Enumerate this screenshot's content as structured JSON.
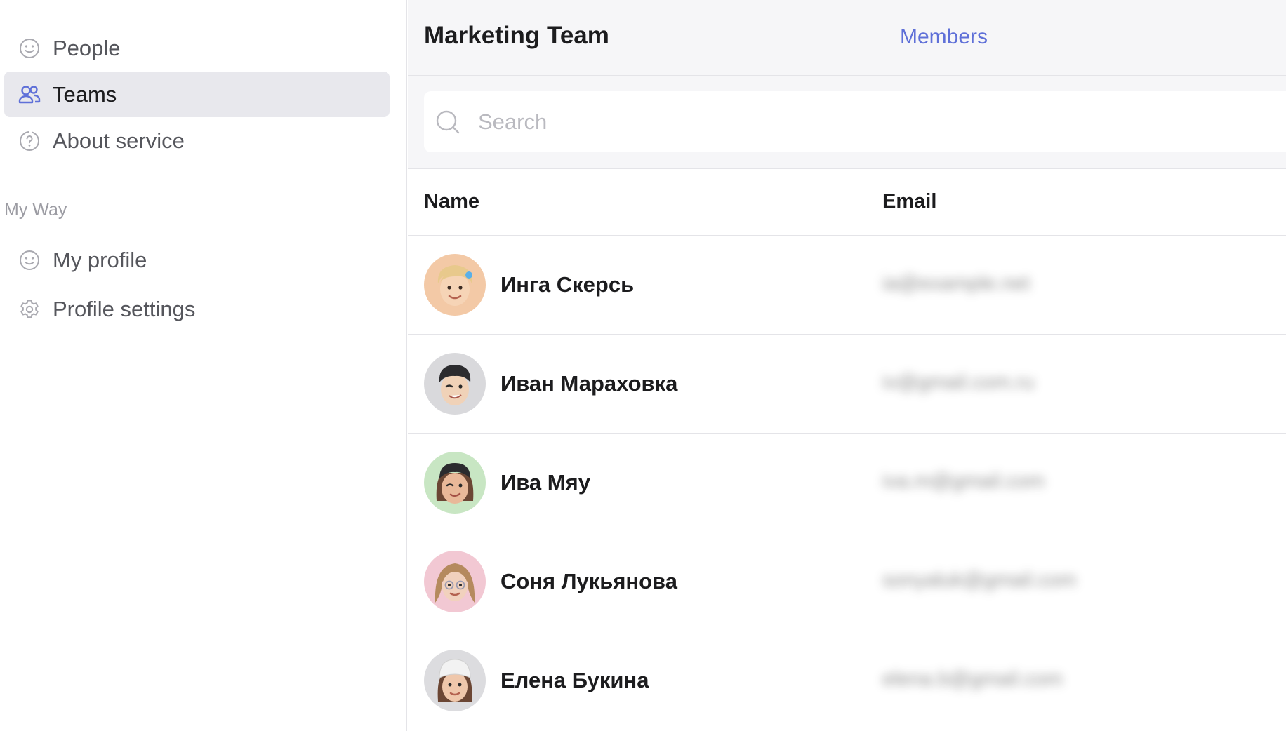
{
  "sidebar": {
    "items": [
      {
        "label": "People",
        "icon": "smile-icon",
        "active": false
      },
      {
        "label": "Teams",
        "icon": "team-icon",
        "active": true
      },
      {
        "label": "About service",
        "icon": "question-icon",
        "active": false
      }
    ],
    "section_title": "My Way",
    "section_items": [
      {
        "label": "My profile",
        "icon": "smile-icon"
      },
      {
        "label": "Profile settings",
        "icon": "gear-icon"
      }
    ]
  },
  "header": {
    "title": "Marketing Team",
    "tab": "Members"
  },
  "search": {
    "placeholder": "Search",
    "value": ""
  },
  "table": {
    "columns": [
      "Name",
      "Email"
    ],
    "rows": [
      {
        "name": "Инга Скерсь",
        "email": "ia@example.net",
        "avatar_bg": "#f3c9a6"
      },
      {
        "name": "Иван Мараховка",
        "email": "iv@gmail.com.ru",
        "avatar_bg": "#d9d9dc"
      },
      {
        "name": "Ива Мяу",
        "email": "iva.m@gmail.com",
        "avatar_bg": "#c8e6c3"
      },
      {
        "name": "Соня Лукьянова",
        "email": "sonyaluk@gmail.com",
        "avatar_bg": "#f2c8d3"
      },
      {
        "name": "Елена Букина",
        "email": "elena.b@gmail.com",
        "avatar_bg": "#dcdcdf"
      }
    ]
  },
  "colors": {
    "accent": "#5f70d8",
    "active_bg": "#e8e8ed",
    "topbar_bg": "#f6f6f8"
  }
}
